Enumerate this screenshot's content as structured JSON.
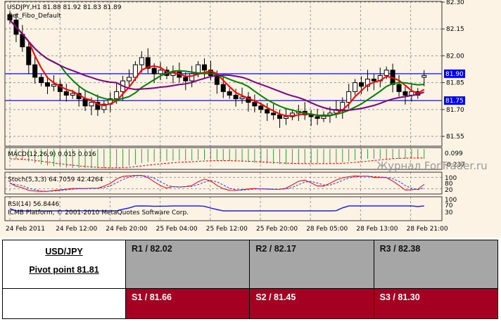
{
  "chart": {
    "header": "USDJPY,H1  81.88 81.92 81.83 81.89",
    "template": "Set_Fibo_Default",
    "copyright": "ICMB Platform, © 2001-2010 MetaQuotes Software Corp.",
    "watermark": "Журнал ForTrader.ru",
    "price_ticks": [
      "82.30",
      "82.15",
      "82.00",
      "81.85",
      "81.70",
      "81.55"
    ],
    "price_tick_values": [
      82.3,
      82.15,
      82.0,
      81.85,
      81.7,
      81.55
    ],
    "hlines": [
      {
        "label": "81.90",
        "value": 81.9
      },
      {
        "label": "81.75",
        "value": 81.75
      }
    ],
    "time_labels": [
      "24 Feb 2011",
      "24 Feb 12:00",
      "24 Feb 20:00",
      "25 Feb 04:00",
      "25 Feb 12:00",
      "25 Feb 20:00",
      "28 Feb 05:00",
      "28 Feb 13:00",
      "28 Feb 21:00"
    ],
    "closes": [
      82.2,
      82.12,
      82.05,
      81.95,
      81.88,
      81.85,
      81.83,
      81.84,
      81.8,
      81.78,
      81.79,
      81.76,
      81.72,
      81.74,
      81.7,
      81.73,
      81.76,
      81.8,
      81.86,
      81.88,
      81.95,
      81.99,
      81.93,
      81.9,
      81.92,
      81.89,
      81.91,
      81.88,
      81.86,
      81.9,
      81.95,
      81.92,
      81.89,
      81.84,
      81.8,
      81.78,
      81.76,
      81.77,
      81.74,
      81.72,
      81.7,
      81.68,
      81.67,
      81.65,
      81.66,
      81.68,
      81.69,
      81.67,
      81.66,
      81.65,
      81.67,
      81.68,
      81.7,
      81.74,
      81.8,
      81.85,
      81.83,
      81.87,
      81.86,
      81.89,
      81.92,
      81.84,
      81.8,
      81.78,
      81.8,
      81.78,
      81.89
    ],
    "last_candle": {
      "open": 81.88,
      "high": 81.92,
      "low": 81.83,
      "close": 81.89
    },
    "colors": {
      "bg": "#fcf3e4",
      "up": "#ffffff",
      "down": "#000000",
      "ma_fast": "#ff0000",
      "ma_mid": "#008000",
      "ma_slow": "#800080",
      "level": "#3030ff"
    },
    "macd": {
      "label": "MACD(12,26,9) 0.015 0.016",
      "ticks": [
        "0.099",
        "-0.237"
      ]
    },
    "stoch": {
      "label": "Stoch(5,3,3) 64.7059 42.4264",
      "ticks": [
        "100",
        "80",
        "20"
      ]
    },
    "rsi": {
      "label": "RSI(14) 56.8446",
      "ticks": [
        "100",
        "70",
        "30"
      ]
    }
  },
  "pivots": {
    "pair": "USD/JPY",
    "pivot": "Pivot point 81.81",
    "resistance": [
      "R1 / 82.02",
      "R2 / 82.17",
      "R3 / 82.38"
    ],
    "support": [
      "S1 / 81.66",
      "S2 / 81.45",
      "S3 / 81.30"
    ]
  }
}
